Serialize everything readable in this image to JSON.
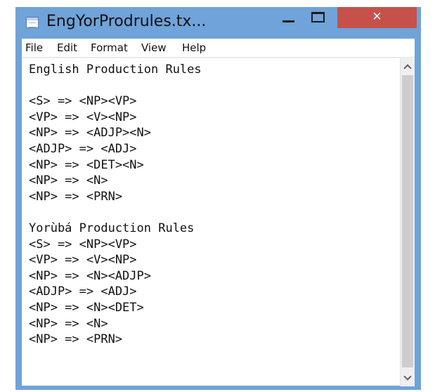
{
  "window": {
    "title": "EngYorProdrules.tx...",
    "close_glyph": "✕",
    "icons": [
      "notepad-icon",
      "minimize-icon",
      "maximize-icon",
      "close-icon"
    ]
  },
  "menu": [
    "File",
    "Edit",
    "Format",
    "View",
    "Help"
  ],
  "document": {
    "lines": [
      "English Production Rules",
      "",
      "<S> => <NP><VP>",
      "<VP> => <V><NP>",
      "<NP> => <ADJP><N>",
      "<ADJP> => <ADJ>",
      "<NP> => <DET><N>",
      "<NP> => <N>",
      "<NP> => <PRN>",
      "",
      "Yorùbá Production Rules",
      "<S> => <NP><VP>",
      "<VP> => <V><NP>",
      "<NP> => <N><ADJP>",
      "<ADJP> => <ADJ>",
      "<NP> => <N><DET>",
      "<NP> => <N>",
      "<NP> => <PRN>"
    ]
  },
  "colors": {
    "titlebar": "#6fa3d9",
    "close_button": "#c6514b",
    "scrollbar_track": "#efefef",
    "scrollbar_thumb": "#cdcdcd"
  }
}
